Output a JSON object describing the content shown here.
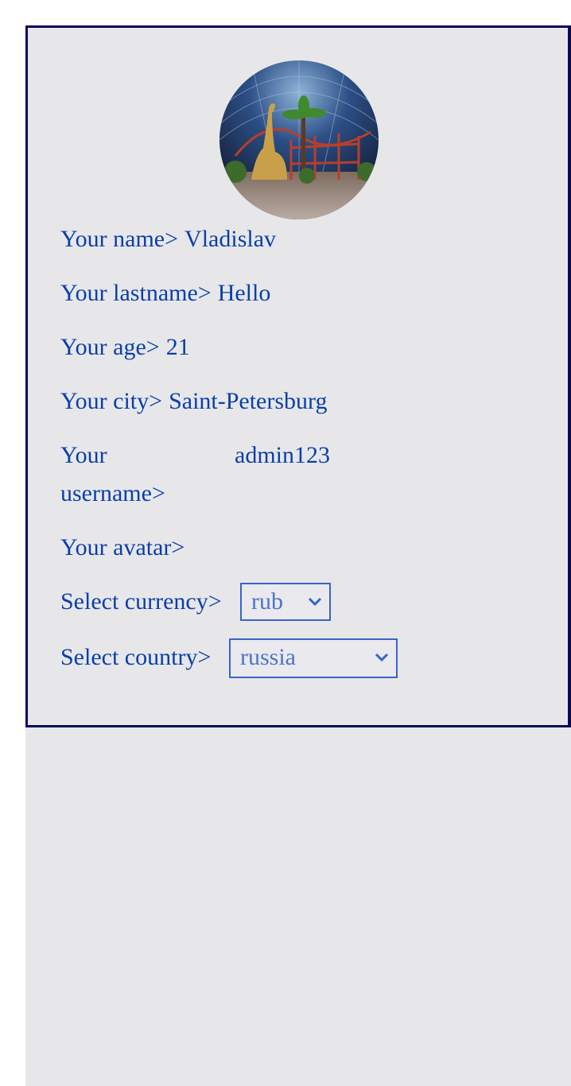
{
  "profile": {
    "name_label": "Your name>",
    "name_value": "Vladislav",
    "lastname_label": "Your lastname>",
    "lastname_value": "Hello",
    "age_label": "Your age>",
    "age_value": "21",
    "city_label": "Your city>",
    "city_value": "Saint-Petersburg",
    "username_label": "Your username>",
    "username_value": "admin123",
    "avatar_label": "Your avatar>"
  },
  "currency": {
    "label": "Select currency>",
    "selected": "rub"
  },
  "country": {
    "label": "Select country>",
    "selected": "russia"
  },
  "avatar_image": {
    "icon": "avatar-photo-theme-park"
  },
  "colors": {
    "text": "#0b3fa8",
    "border": "#0a0a5a",
    "panel": "#e7e7ea",
    "select_border": "#3b63c7"
  }
}
